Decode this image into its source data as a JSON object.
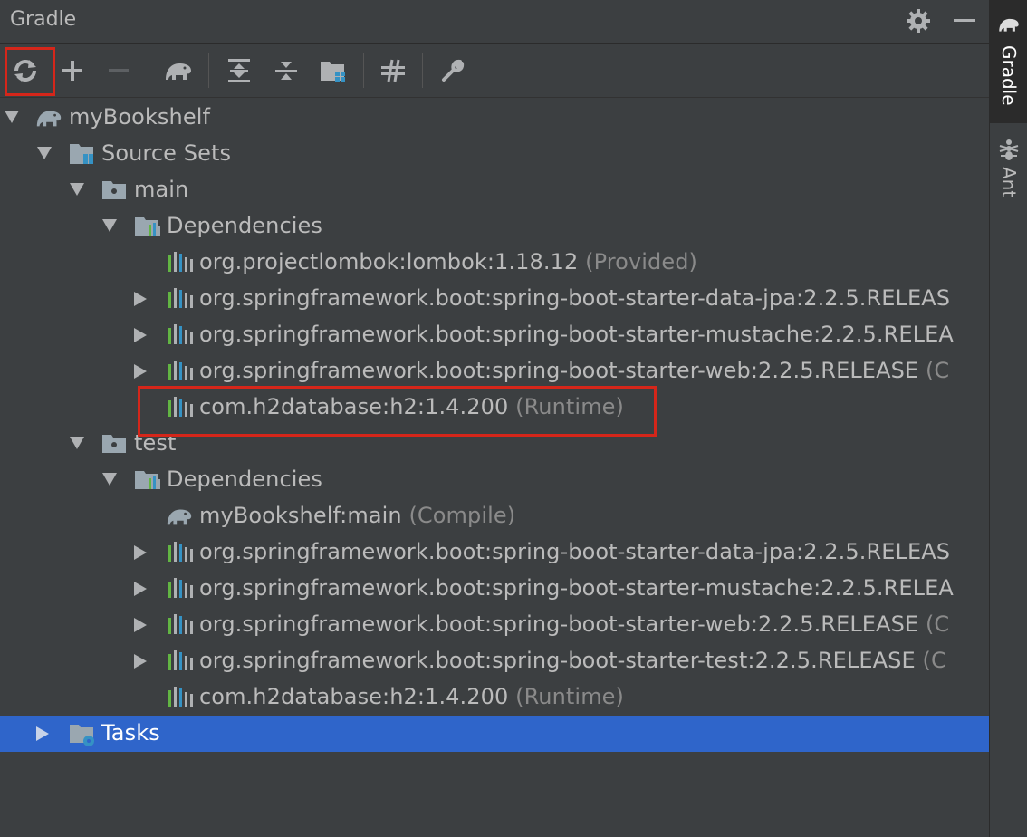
{
  "panel": {
    "title": "Gradle"
  },
  "toolbar": {
    "buttons": [
      {
        "icon": "refresh-icon",
        "tooltip": ""
      },
      {
        "icon": "plus-icon"
      },
      {
        "icon": "minus-icon"
      },
      {
        "icon": "elephant-icon"
      },
      {
        "icon": "expand-all-icon"
      },
      {
        "icon": "collapse-all-icon"
      },
      {
        "icon": "group-modules-icon"
      },
      {
        "icon": "toggle-offline-icon"
      },
      {
        "icon": "wrench-icon"
      }
    ]
  },
  "tree": {
    "root": "myBookshelf",
    "source_sets": "Source Sets",
    "main": "main",
    "main_dependencies": "Dependencies",
    "main_deps": [
      {
        "name": "org.projectlombok:lombok:1.18.12",
        "scope": "(Provided)",
        "expandable": false
      },
      {
        "name": "org.springframework.boot:spring-boot-starter-data-jpa:2.2.5.RELEAS",
        "scope": "",
        "expandable": true
      },
      {
        "name": "org.springframework.boot:spring-boot-starter-mustache:2.2.5.RELEA",
        "scope": "",
        "expandable": true
      },
      {
        "name": "org.springframework.boot:spring-boot-starter-web:2.2.5.RELEASE",
        "scope": "(C",
        "expandable": true
      },
      {
        "name": "com.h2database:h2:1.4.200",
        "scope": "(Runtime)",
        "expandable": false
      }
    ],
    "test": "test",
    "test_dependencies": "Dependencies",
    "test_deps": [
      {
        "name": "myBookshelf:main",
        "scope": "(Compile)",
        "expandable": false,
        "module": true
      },
      {
        "name": "org.springframework.boot:spring-boot-starter-data-jpa:2.2.5.RELEAS",
        "scope": "",
        "expandable": true
      },
      {
        "name": "org.springframework.boot:spring-boot-starter-mustache:2.2.5.RELEA",
        "scope": "",
        "expandable": true
      },
      {
        "name": "org.springframework.boot:spring-boot-starter-web:2.2.5.RELEASE",
        "scope": "(C",
        "expandable": true
      },
      {
        "name": "org.springframework.boot:spring-boot-starter-test:2.2.5.RELEASE",
        "scope": "(C",
        "expandable": true
      },
      {
        "name": "com.h2database:h2:1.4.200",
        "scope": "(Runtime)",
        "expandable": false
      }
    ],
    "tasks": "Tasks"
  },
  "stripe": {
    "gradle_label": "Gradle",
    "ant_label": "Ant"
  },
  "colors": {
    "background": "#3c3f41",
    "selection": "#2f65ca",
    "highlight": "#d5261a",
    "text": "#bbbbbb",
    "scope_text": "#8a8a8a"
  }
}
